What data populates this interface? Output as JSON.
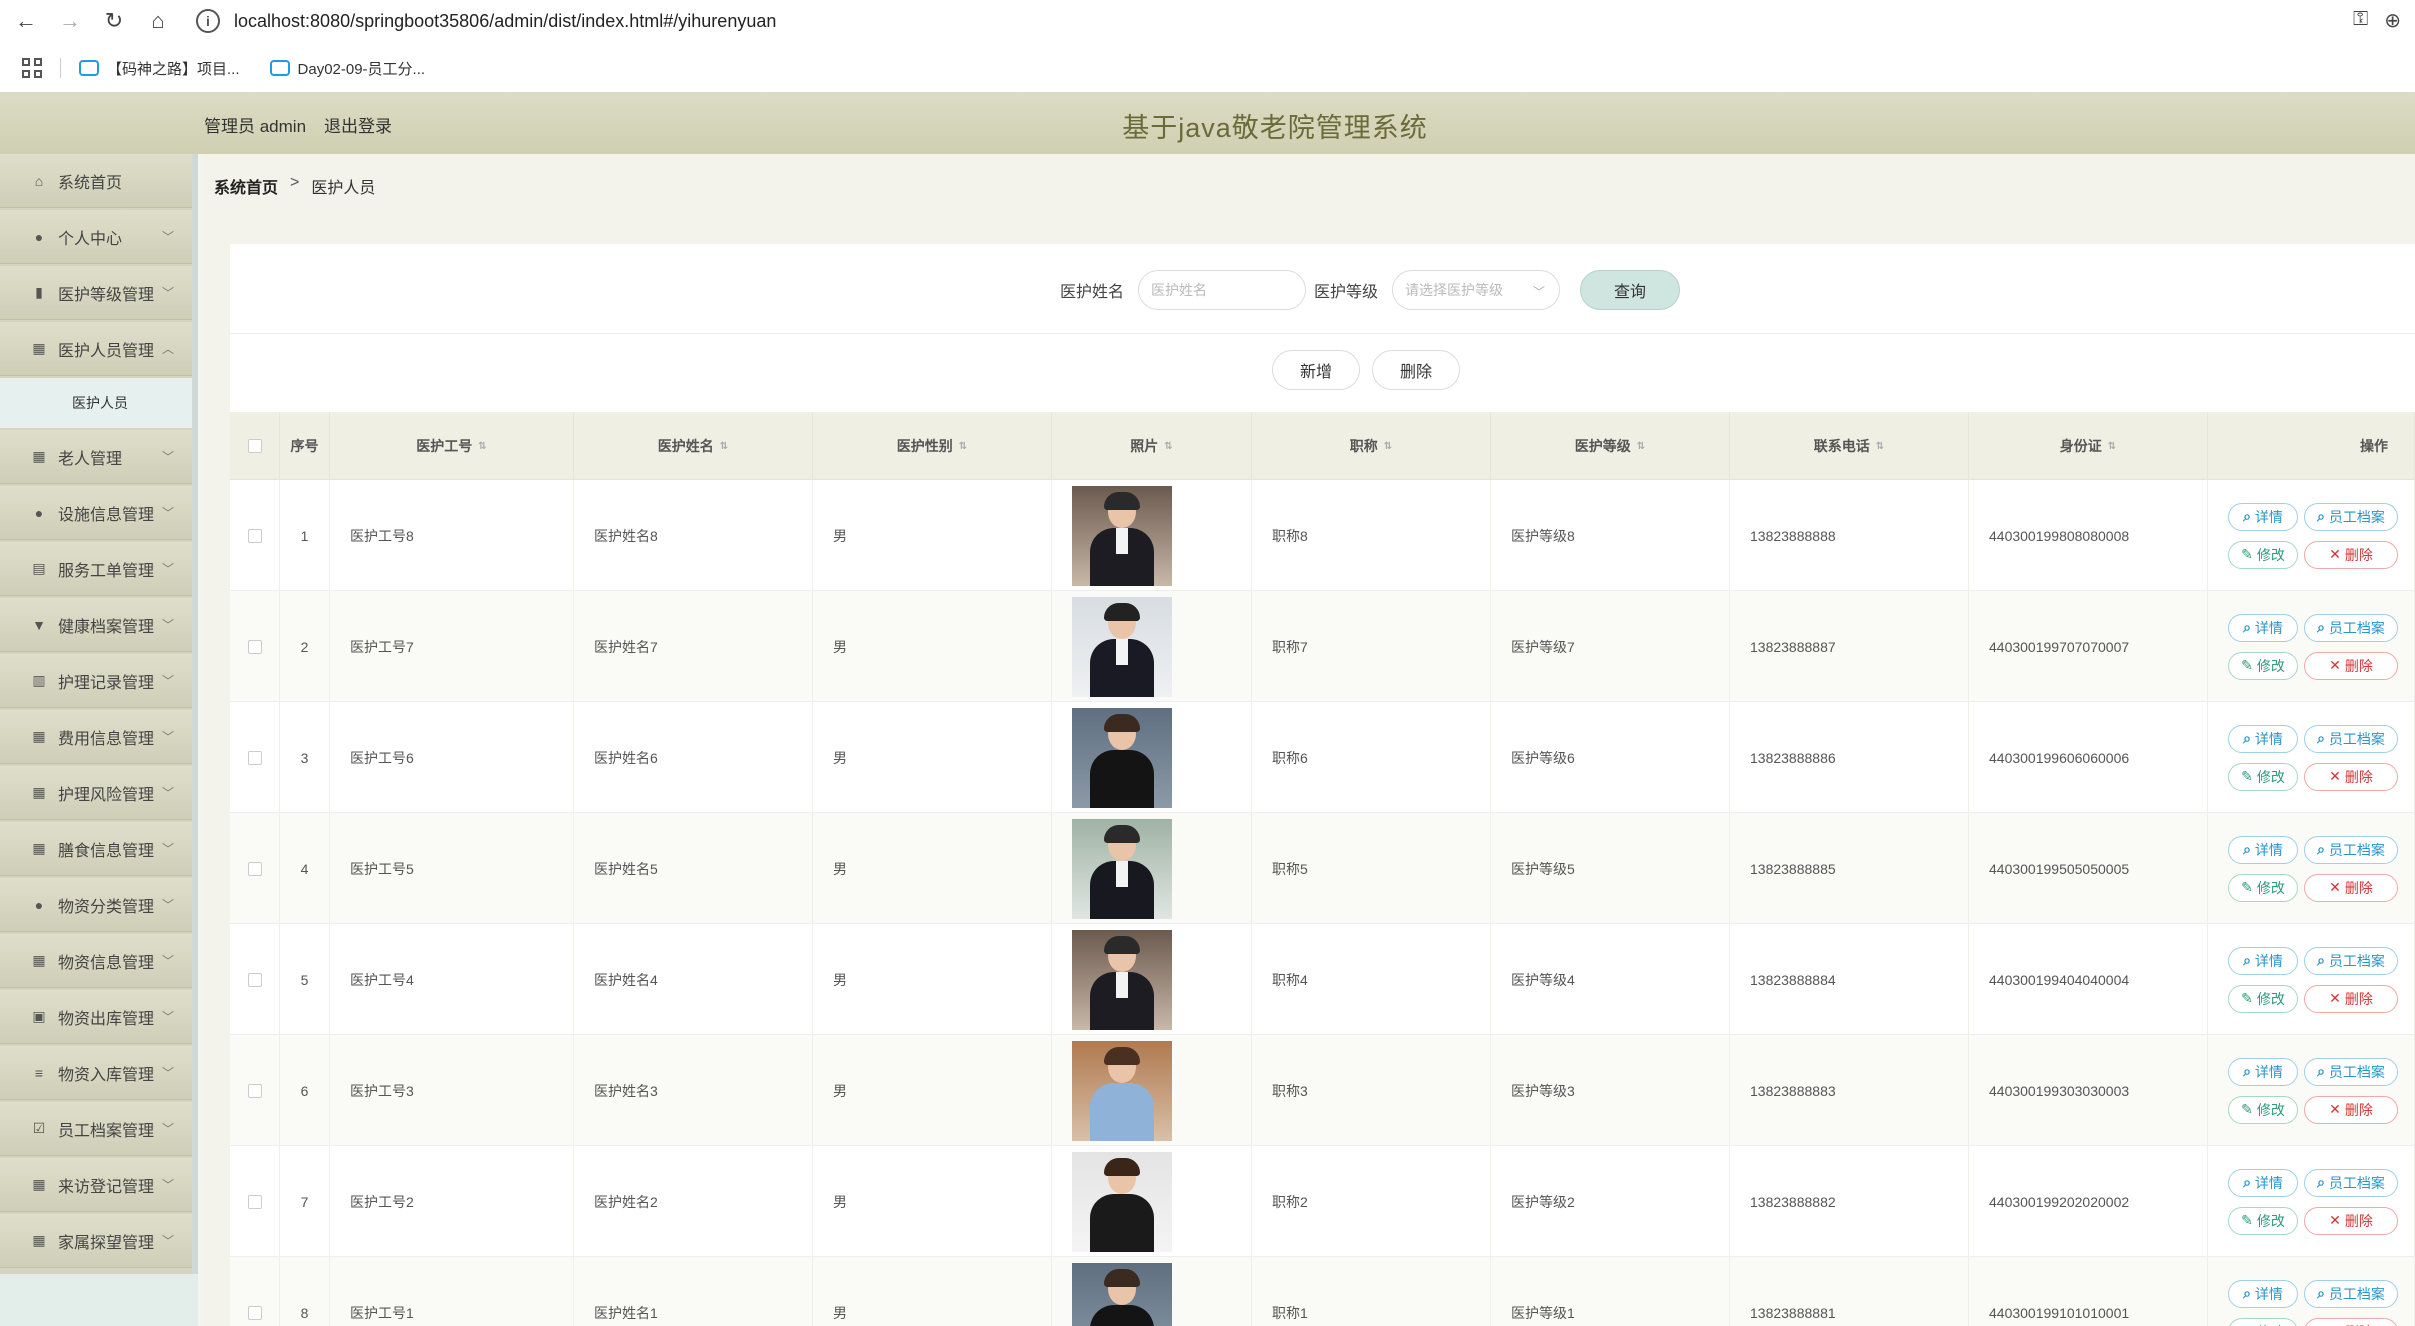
{
  "browser": {
    "url": "localhost:8080/springboot35806/admin/dist/index.html#/yihurenyuan",
    "bookmarks": [
      "【码神之路】项目...",
      "Day02-09-员工分..."
    ]
  },
  "header": {
    "role_user": "管理员 admin",
    "logout": "退出登录",
    "title": "基于java敬老院管理系统"
  },
  "sidebar": {
    "items": [
      {
        "label": "系统首页",
        "icon": "home-icon"
      },
      {
        "label": "个人中心",
        "icon": "user-icon"
      },
      {
        "label": "医护等级管理",
        "icon": "bars-icon"
      },
      {
        "label": "医护人员管理",
        "icon": "grid-icon",
        "expanded": true,
        "sub": [
          "医护人员"
        ]
      },
      {
        "label": "老人管理",
        "icon": "grid-icon"
      },
      {
        "label": "设施信息管理",
        "icon": "user-icon"
      },
      {
        "label": "服务工单管理",
        "icon": "doc-icon"
      },
      {
        "label": "健康档案管理",
        "icon": "cup-icon"
      },
      {
        "label": "护理记录管理",
        "icon": "chart-icon"
      },
      {
        "label": "费用信息管理",
        "icon": "grid-icon"
      },
      {
        "label": "护理风险管理",
        "icon": "grid-icon"
      },
      {
        "label": "膳食信息管理",
        "icon": "grid-icon"
      },
      {
        "label": "物资分类管理",
        "icon": "user-icon"
      },
      {
        "label": "物资信息管理",
        "icon": "grid-icon"
      },
      {
        "label": "物资出库管理",
        "icon": "clipboard-icon"
      },
      {
        "label": "物资入库管理",
        "icon": "list-icon"
      },
      {
        "label": "员工档案管理",
        "icon": "check-icon"
      },
      {
        "label": "来访登记管理",
        "icon": "grid-icon"
      },
      {
        "label": "家属探望管理",
        "icon": "grid-icon"
      }
    ]
  },
  "breadcrumb": {
    "home": "系统首页",
    "sep": ">",
    "current": "医护人员"
  },
  "search": {
    "name_label": "医护姓名",
    "name_placeholder": "医护姓名",
    "level_label": "医护等级",
    "level_placeholder": "请选择医护等级",
    "query": "查询"
  },
  "actions": {
    "add": "新增",
    "delete": "删除"
  },
  "table": {
    "headers": {
      "index": "序号",
      "code": "医护工号",
      "name": "医护姓名",
      "gender": "医护性别",
      "photo": "照片",
      "title": "职称",
      "level": "医护等级",
      "phone": "联系电话",
      "idcard": "身份证",
      "ops": "操作"
    },
    "ops": {
      "detail": "详情",
      "archive": "员工档案",
      "edit": "修改",
      "del": "删除"
    },
    "rows": [
      {
        "idx": "1",
        "code": "医护工号8",
        "name": "医护姓名8",
        "gender": "男",
        "title": "职称8",
        "level": "医护等级8",
        "phone": "13823888888",
        "idcard": "440300199808080008"
      },
      {
        "idx": "2",
        "code": "医护工号7",
        "name": "医护姓名7",
        "gender": "男",
        "title": "职称7",
        "level": "医护等级7",
        "phone": "13823888887",
        "idcard": "440300199707070007"
      },
      {
        "idx": "3",
        "code": "医护工号6",
        "name": "医护姓名6",
        "gender": "男",
        "title": "职称6",
        "level": "医护等级6",
        "phone": "13823888886",
        "idcard": "440300199606060006"
      },
      {
        "idx": "4",
        "code": "医护工号5",
        "name": "医护姓名5",
        "gender": "男",
        "title": "职称5",
        "level": "医护等级5",
        "phone": "13823888885",
        "idcard": "440300199505050005"
      },
      {
        "idx": "5",
        "code": "医护工号4",
        "name": "医护姓名4",
        "gender": "男",
        "title": "职称4",
        "level": "医护等级4",
        "phone": "13823888884",
        "idcard": "440300199404040004"
      },
      {
        "idx": "6",
        "code": "医护工号3",
        "name": "医护姓名3",
        "gender": "男",
        "title": "职称3",
        "level": "医护等级3",
        "phone": "13823888883",
        "idcard": "440300199303030003"
      },
      {
        "idx": "7",
        "code": "医护工号2",
        "name": "医护姓名2",
        "gender": "男",
        "title": "职称2",
        "level": "医护等级2",
        "phone": "13823888882",
        "idcard": "440300199202020002"
      },
      {
        "idx": "8",
        "code": "医护工号1",
        "name": "医护姓名1",
        "gender": "男",
        "title": "职称1",
        "level": "医护等级1",
        "phone": "13823888881",
        "idcard": "440300199101010001"
      }
    ]
  }
}
